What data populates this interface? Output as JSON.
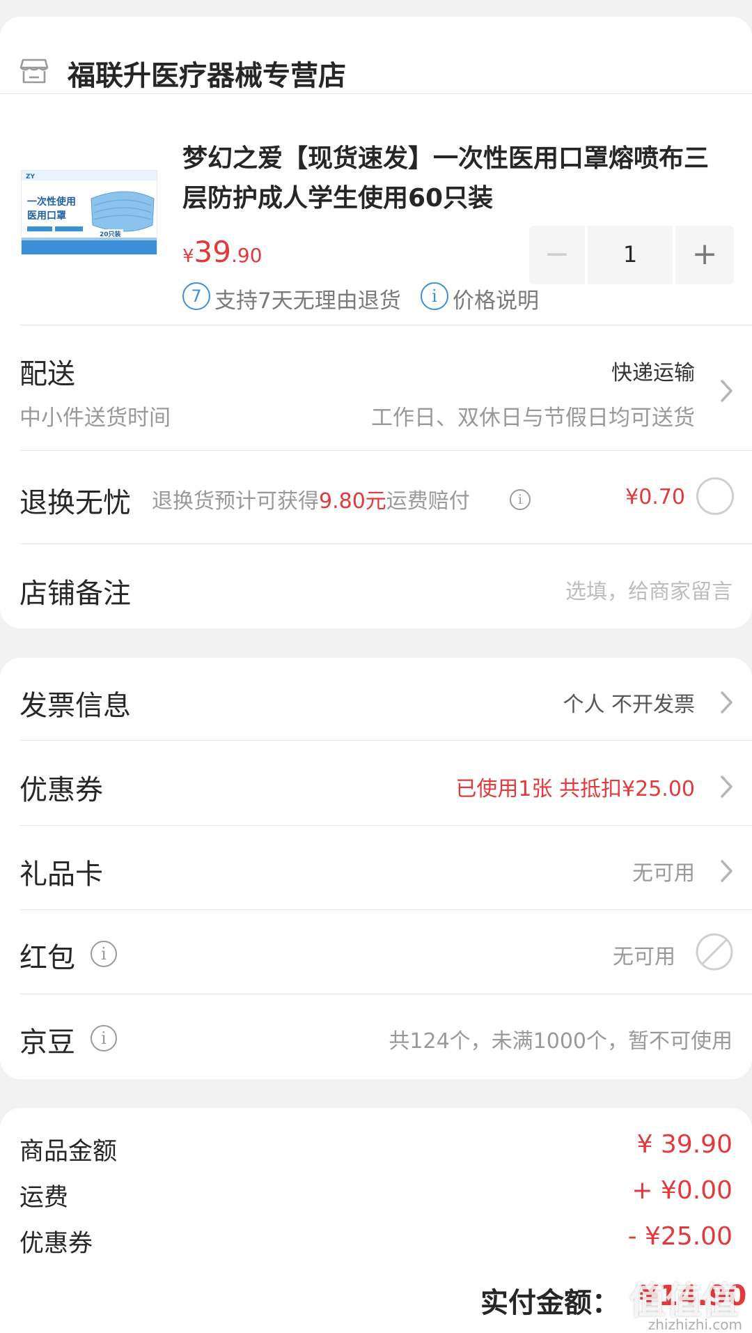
{
  "store": {
    "name": "福联升医疗器械专营店"
  },
  "product": {
    "title": "梦幻之爱【现货速发】一次性医用口罩熔喷布三层防护成人学生使用60只装",
    "price_symbol": "¥",
    "price_int": "39",
    "price_dec": ".90",
    "quantity": "1",
    "minus_label": "−",
    "plus_label": "+",
    "thumb_lines": [
      "一次性使用",
      "医用口罩"
    ],
    "thumb_count": "20只装",
    "services": [
      {
        "badge": "7",
        "label": "支持7天无理由退货"
      },
      {
        "badge": "i",
        "label": "价格说明"
      }
    ]
  },
  "delivery": {
    "label": "配送",
    "method": "快递运输",
    "sub_label": "中小件送货时间",
    "sub_value": "工作日、双休日与节假日均可送货"
  },
  "return_insurance": {
    "label": "退换无忧",
    "desc_pre": "退换货预计可获得",
    "desc_amount": "9.80元",
    "desc_post": "运费赔付",
    "price": "¥0.70"
  },
  "note": {
    "label": "店铺备注",
    "placeholder": "选填，给商家留言"
  },
  "invoice": {
    "label": "发票信息",
    "value": "个人 不开发票"
  },
  "coupon": {
    "label": "优惠券",
    "value": "已使用1张 共抵扣¥25.00"
  },
  "gift_card": {
    "label": "礼品卡",
    "value": "无可用"
  },
  "red_packet": {
    "label": "红包",
    "value": "无可用"
  },
  "jingdou": {
    "label": "京豆",
    "value": "共124个，未满1000个，暂不可使用"
  },
  "summary": {
    "goods_label": "商品金额",
    "goods_value": "¥ 39.90",
    "freight_label": "运费",
    "freight_value": "+ ¥0.00",
    "coupon_label": "优惠券",
    "coupon_value": "- ¥25.00",
    "total_label": "实付金额：",
    "total_value": "¥14.90"
  },
  "watermark": {
    "main": "值值值",
    "sub": "zhizhizhi.com"
  },
  "colors": {
    "accent_red": "#e4393c",
    "service_blue": "#3b8fe3",
    "background": "#f2f2f2"
  }
}
